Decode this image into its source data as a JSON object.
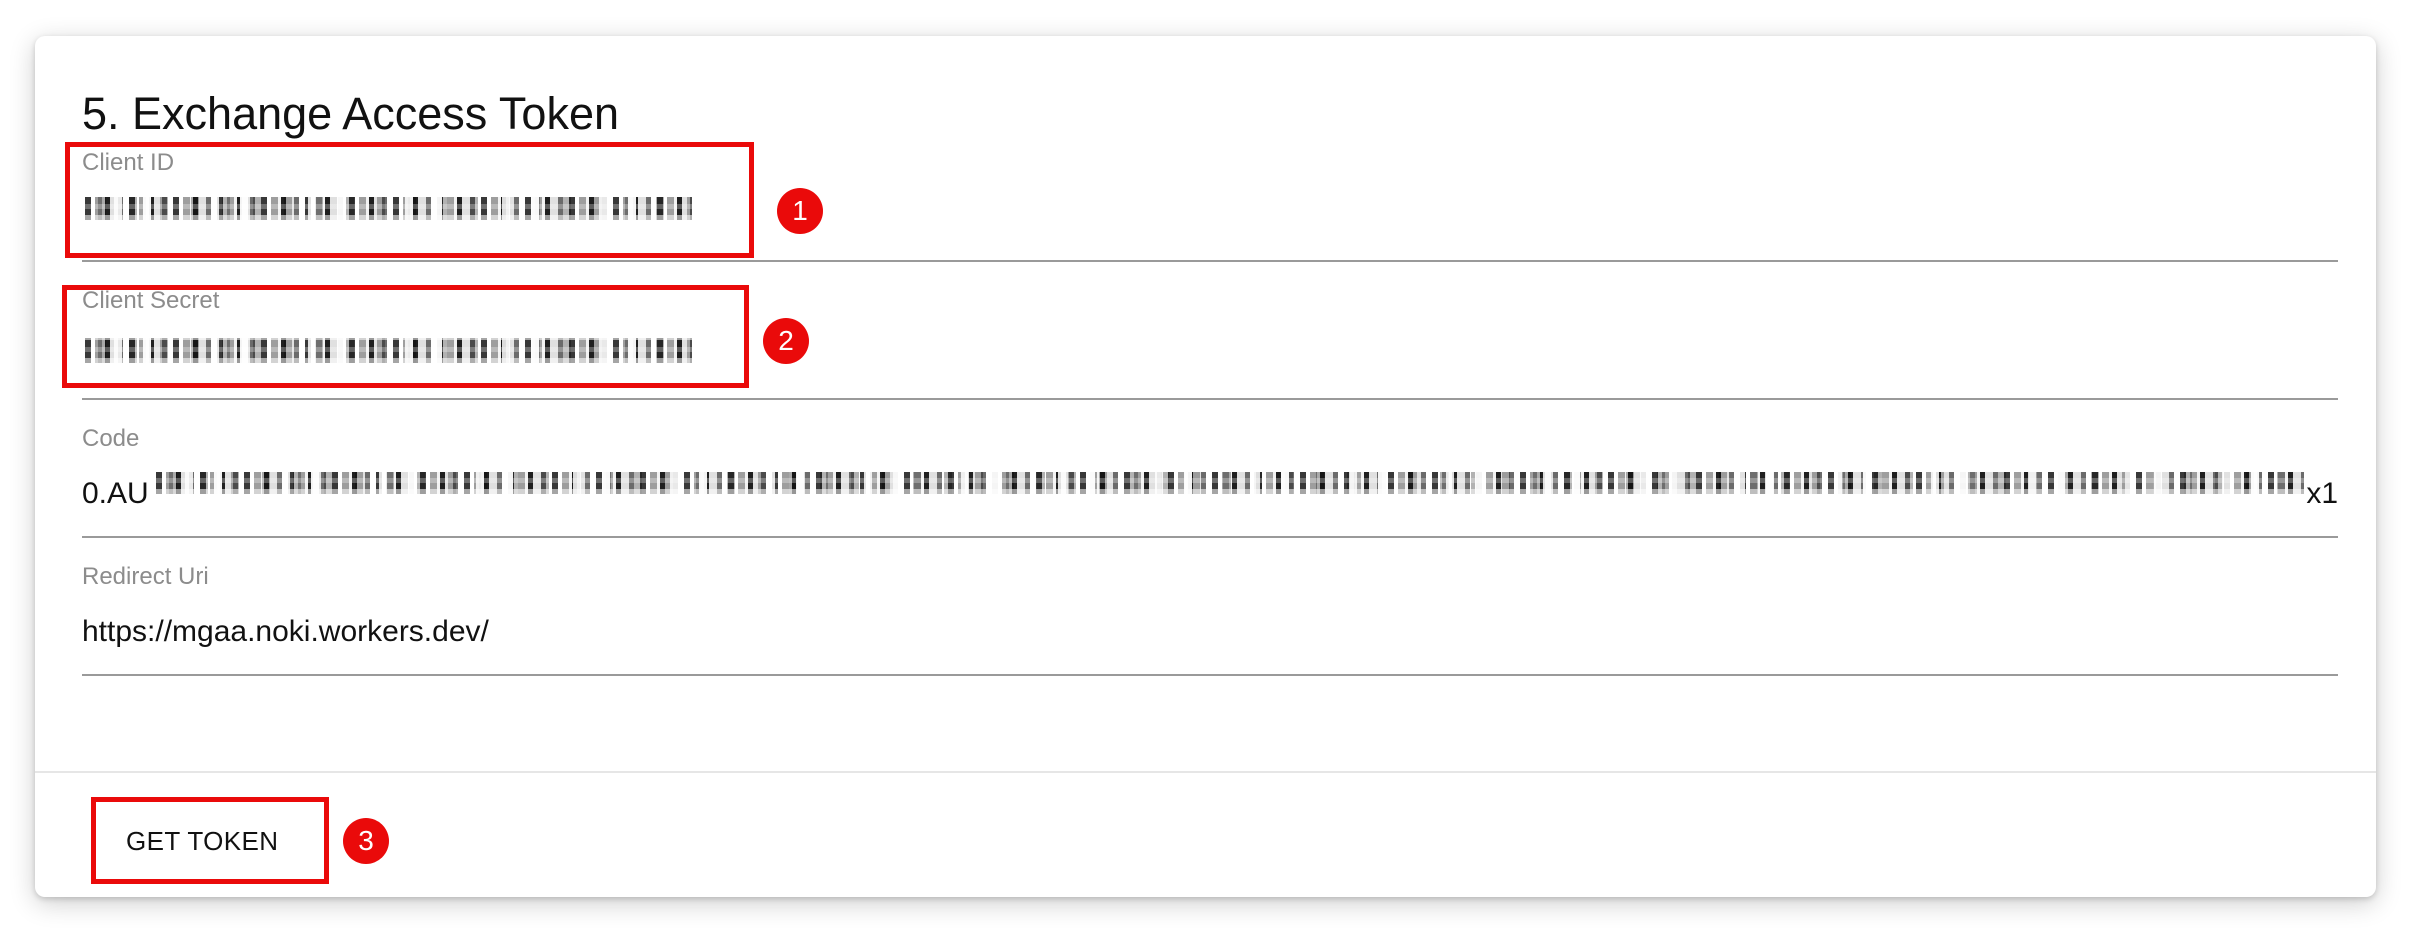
{
  "title": "5. Exchange Access Token",
  "fields": [
    {
      "label": "Client ID"
    },
    {
      "label": "Client Secret"
    },
    {
      "label": "Code",
      "value_prefix": "0.AU",
      "value_suffix": "x1"
    },
    {
      "label": "Redirect Uri",
      "value": "https://mgaa.noki.workers.dev/"
    }
  ],
  "button": {
    "label": "GET TOKEN"
  },
  "annotations": [
    {
      "number": "1"
    },
    {
      "number": "2"
    },
    {
      "number": "3"
    }
  ],
  "colors": {
    "annotation_red": "#ea0a0a",
    "label_gray": "#8c8c8c",
    "text": "#111111",
    "underline": "#9a9a9a",
    "card_background": "#ffffff"
  }
}
